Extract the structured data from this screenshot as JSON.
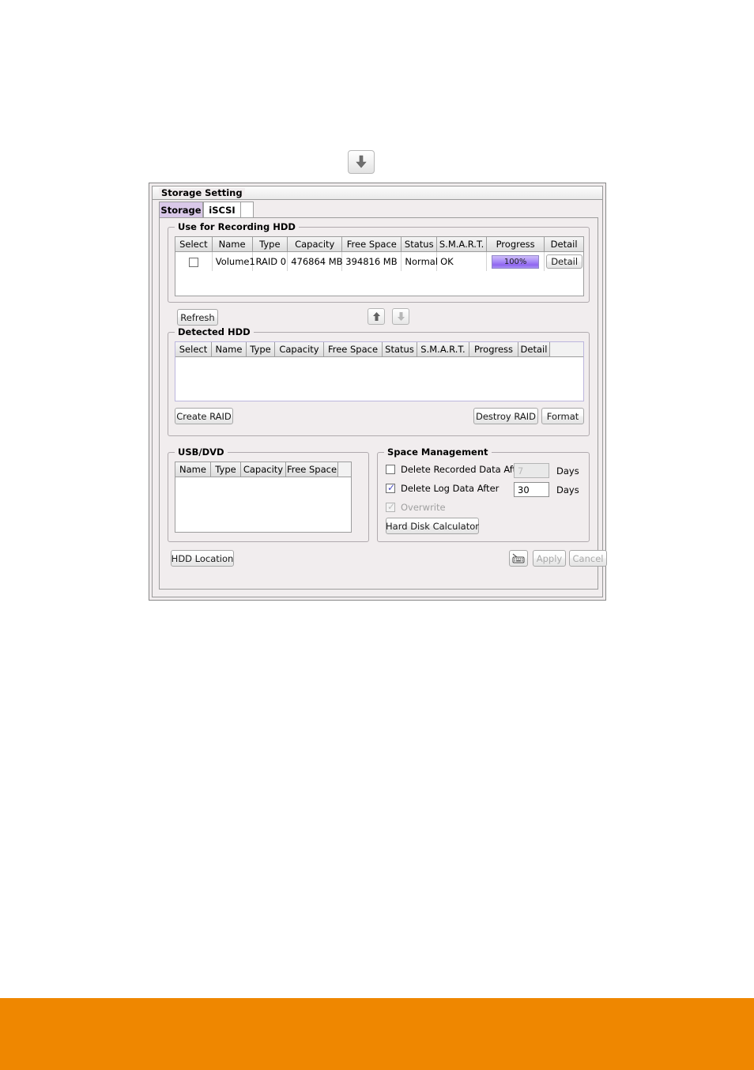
{
  "page": {
    "background_color": "#ffffff",
    "footer_band_color": "#ef8700"
  },
  "top_badge": {
    "icon": "arrow-down-icon",
    "tooltip": ""
  },
  "dialog": {
    "title": "Storage Setting",
    "tabs": [
      {
        "label": "Storage",
        "active": true
      },
      {
        "label": "iSCSI",
        "active": false
      }
    ],
    "accent_color": "#d9c8e8"
  },
  "recording_hdd": {
    "group_title": "Use for Recording HDD",
    "columns": [
      "Select",
      "Name",
      "Type",
      "Capacity",
      "Free Space",
      "Status",
      "S.M.A.R.T.",
      "Progress",
      "Detail"
    ],
    "rows": [
      {
        "select": false,
        "name": "Volume1",
        "type": "RAID 0",
        "capacity": "476864 MB",
        "free_space": "394816 MB",
        "status": "Normal",
        "smart": "OK",
        "progress": "100%",
        "progress_value": 100,
        "detail_label": "Detail"
      }
    ]
  },
  "middle_controls": {
    "refresh_label": "Refresh",
    "move_up_icon": "arrow-up-icon",
    "move_down_icon": "arrow-down-icon"
  },
  "detected_hdd": {
    "group_title": "Detected HDD",
    "columns": [
      "Select",
      "Name",
      "Type",
      "Capacity",
      "Free Space",
      "Status",
      "S.M.A.R.T.",
      "Progress",
      "Detail"
    ],
    "rows": [],
    "create_raid_label": "Create RAID",
    "destroy_raid_label": "Destroy RAID",
    "format_label": "Format"
  },
  "usb_dvd": {
    "group_title": "USB/DVD",
    "columns": [
      "Name",
      "Type",
      "Capacity",
      "Free Space"
    ],
    "rows": []
  },
  "space_management": {
    "group_title": "Space Management",
    "delete_recorded": {
      "label": "Delete Recorded Data After",
      "checked": false,
      "enabled": false,
      "value": "7",
      "unit": "Days"
    },
    "delete_log": {
      "label": "Delete Log Data After",
      "checked": true,
      "enabled": true,
      "value": "30",
      "unit": "Days"
    },
    "overwrite": {
      "label": "Overwrite",
      "checked": true,
      "enabled": false
    },
    "hard_disk_calculator_label": "Hard Disk Calculator"
  },
  "footer": {
    "hdd_location_label": "HDD Location",
    "keyboard_icon": "keyboard-icon",
    "apply_label": "Apply",
    "apply_enabled": false,
    "cancel_label": "Cancel",
    "cancel_enabled": false
  }
}
